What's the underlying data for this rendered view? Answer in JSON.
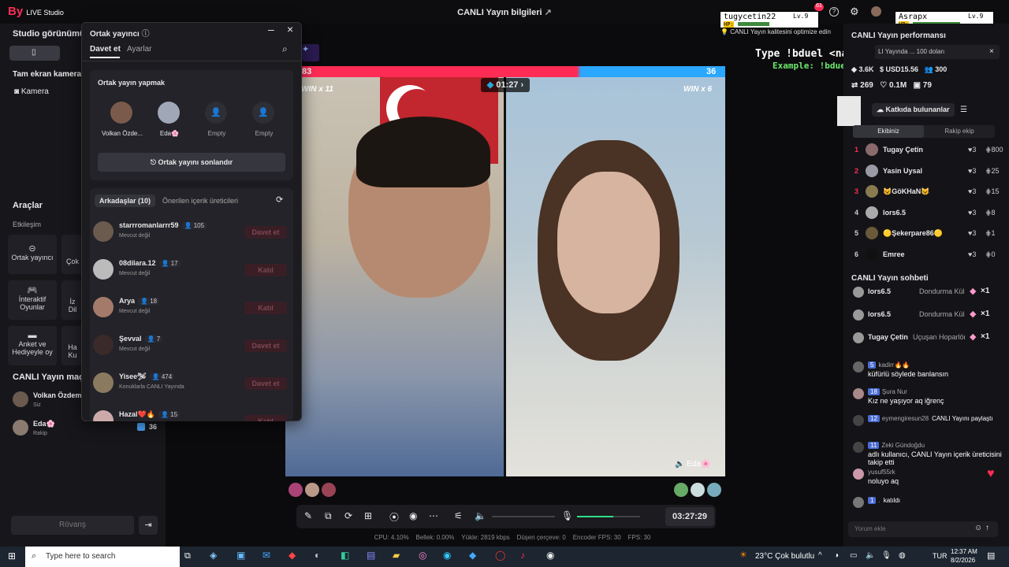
{
  "app": {
    "logo_left": "By",
    "logo_right": "LIVE Studio",
    "title": "CANLI Yayın bilgileri"
  },
  "top_right": {
    "notification_count": "61",
    "overlay1_name": "tugycetin22",
    "overlay1_level": "Lv.9",
    "overlay1_hp": "HP:",
    "overlay2_name": "Asrapx",
    "overlay2_level": "Lv.9",
    "overlay2_hp": "HP:",
    "quality_tip": "CANLI Yayın kalitesini optimize edin"
  },
  "left": {
    "studio_view": "Studio görünümü",
    "fullscreen_camera": "Tam ekran kamera",
    "camera": "Kamera",
    "tools": "Araçlar",
    "interaction": "Etkileşim",
    "tool_cohost": "Ortak yayıncı",
    "tool_cok": "Çok",
    "tool_interactive": "İnteraktif Oyunlar",
    "tool_iz": "İz",
    "tool_dil": "Dil",
    "tool_poll": "Anket ve Hediyeyle oy",
    "tool_ha": "Ha",
    "tool_ku": "Ku",
    "match_title": "CANLI Yayın maçı",
    "match_p1_name": "Volkan Özdemir",
    "match_p1_role": "Siz",
    "match_p2_name": "Eda🌸",
    "match_p2_role": "Rakip",
    "match_p2_score": "36",
    "rematch": "Rövanş"
  },
  "popup": {
    "title": "Ortak yayıncı",
    "tab_invite": "Davet et",
    "tab_settings": "Ayarlar",
    "section": "Ortak yayın yapmak",
    "slots": [
      "Volkan Özde...",
      "Eda🌸",
      "Empty",
      "Empty"
    ],
    "end_button": "Ortak yayını sonlandır",
    "list_tab_friends": "Arkadaşlar (10)",
    "list_tab_suggested": "Önerilen içerik üreticileri",
    "friends": [
      {
        "name": "starrromanlarrr59",
        "count": "105",
        "status": "Mevcut değil",
        "action": "Davet et"
      },
      {
        "name": "08dilara.12",
        "count": "17",
        "status": "Mevcut değil",
        "action": "Katıl"
      },
      {
        "name": "Arya",
        "count": "18",
        "status": "Mevcut değil",
        "action": "Katıl"
      },
      {
        "name": "Şevval",
        "count": "7",
        "status": "Mevcut değil",
        "action": "Davet et"
      },
      {
        "name": "Yisee🛩",
        "count": "474",
        "status": "Konuklarla CANLI Yayında",
        "action": "Davet et"
      },
      {
        "name": "Hazal❤️🔥",
        "count": "15",
        "status": "",
        "action": "Katıl"
      }
    ]
  },
  "stream": {
    "score_left": "83",
    "score_right": "36",
    "timer": "01:27",
    "win_left": "WIN x 11",
    "win_right": "WIN x 6",
    "guest_label": "Eda🌸",
    "overlay_cmd": "Type !bduel <name> to play",
    "overlay_example": "Example: !bduel Asrapx",
    "elapsed": "03:27:29"
  },
  "status": {
    "cpu": "CPU: 4.10%",
    "bellek": "Bellek: 0.00%",
    "yukle": "Yükle: 2819 kbps",
    "dusen": "Düşen çerçeve: 0",
    "encoder": "Encoder FPS: 30",
    "fps": "FPS: 30"
  },
  "right": {
    "perf_title": "CANLI Yayın performansı",
    "banner_text": "LI Yayında ... 100 doları",
    "stat1": "3.6K",
    "stat2": "USD15.56",
    "stat3": "300",
    "stat4": "269",
    "stat5": "0.1M",
    "stat6": "79",
    "contributors": "Katkıda bulunanlar",
    "tab_team": "Ekibiniz",
    "tab_rival": "Rakip ekip",
    "ranking": [
      {
        "rank": "1",
        "name": "Tugay Çetin",
        "hearts": "3",
        "score": "800"
      },
      {
        "rank": "2",
        "name": "Yasin Uysal",
        "hearts": "3",
        "score": "25"
      },
      {
        "rank": "3",
        "name": "😺GöKHaN😺",
        "hearts": "3",
        "score": "15"
      },
      {
        "rank": "4",
        "name": "lors6.5",
        "hearts": "3",
        "score": "8"
      },
      {
        "rank": "5",
        "name": "🟡Şekerpare86🟡",
        "hearts": "3",
        "score": "1"
      },
      {
        "rank": "6",
        "name": "Emree",
        "hearts": "3",
        "score": "0"
      }
    ],
    "chat_title": "CANLI Yayın sohbeti",
    "gifts": [
      {
        "name": "lors6.5",
        "gift": "Dondurma Külahı gönd",
        "qty": "×1"
      },
      {
        "name": "lors6.5",
        "gift": "Dondurma Külahı gönd",
        "qty": "×1"
      },
      {
        "name": "Tugay Çetin",
        "gift": "Uçuşan Hoparlörl",
        "qty": "×1"
      }
    ],
    "chat": [
      {
        "name": "kadirr🔥🔥",
        "level": "5",
        "text": "küfürlü söylede banlansın"
      },
      {
        "name": "Şura Nur",
        "level": "18",
        "text": "Kız ne yaşıyor aq iğrenç"
      },
      {
        "name": "eymengiresun28",
        "level": "12",
        "text": "CANLI Yayını paylaştı"
      },
      {
        "name": "Zeki Gündoğdu",
        "level": "11",
        "text": "adlı kullanıcı, CANLI Yayın içerik üreticisini takip etti"
      },
      {
        "name": "yusuf55rk",
        "level": "",
        "text": "noluyo aq"
      },
      {
        "name": ".",
        "level": "1",
        "text": "katıldı"
      }
    ],
    "comment_placeholder": "Yorum ekle"
  },
  "taskbar": {
    "search_placeholder": "Type here to search",
    "weather": "23°C  Çok bulutlu",
    "lang": "TUR",
    "time": "12:37 AM",
    "date": "8/2/2026"
  }
}
